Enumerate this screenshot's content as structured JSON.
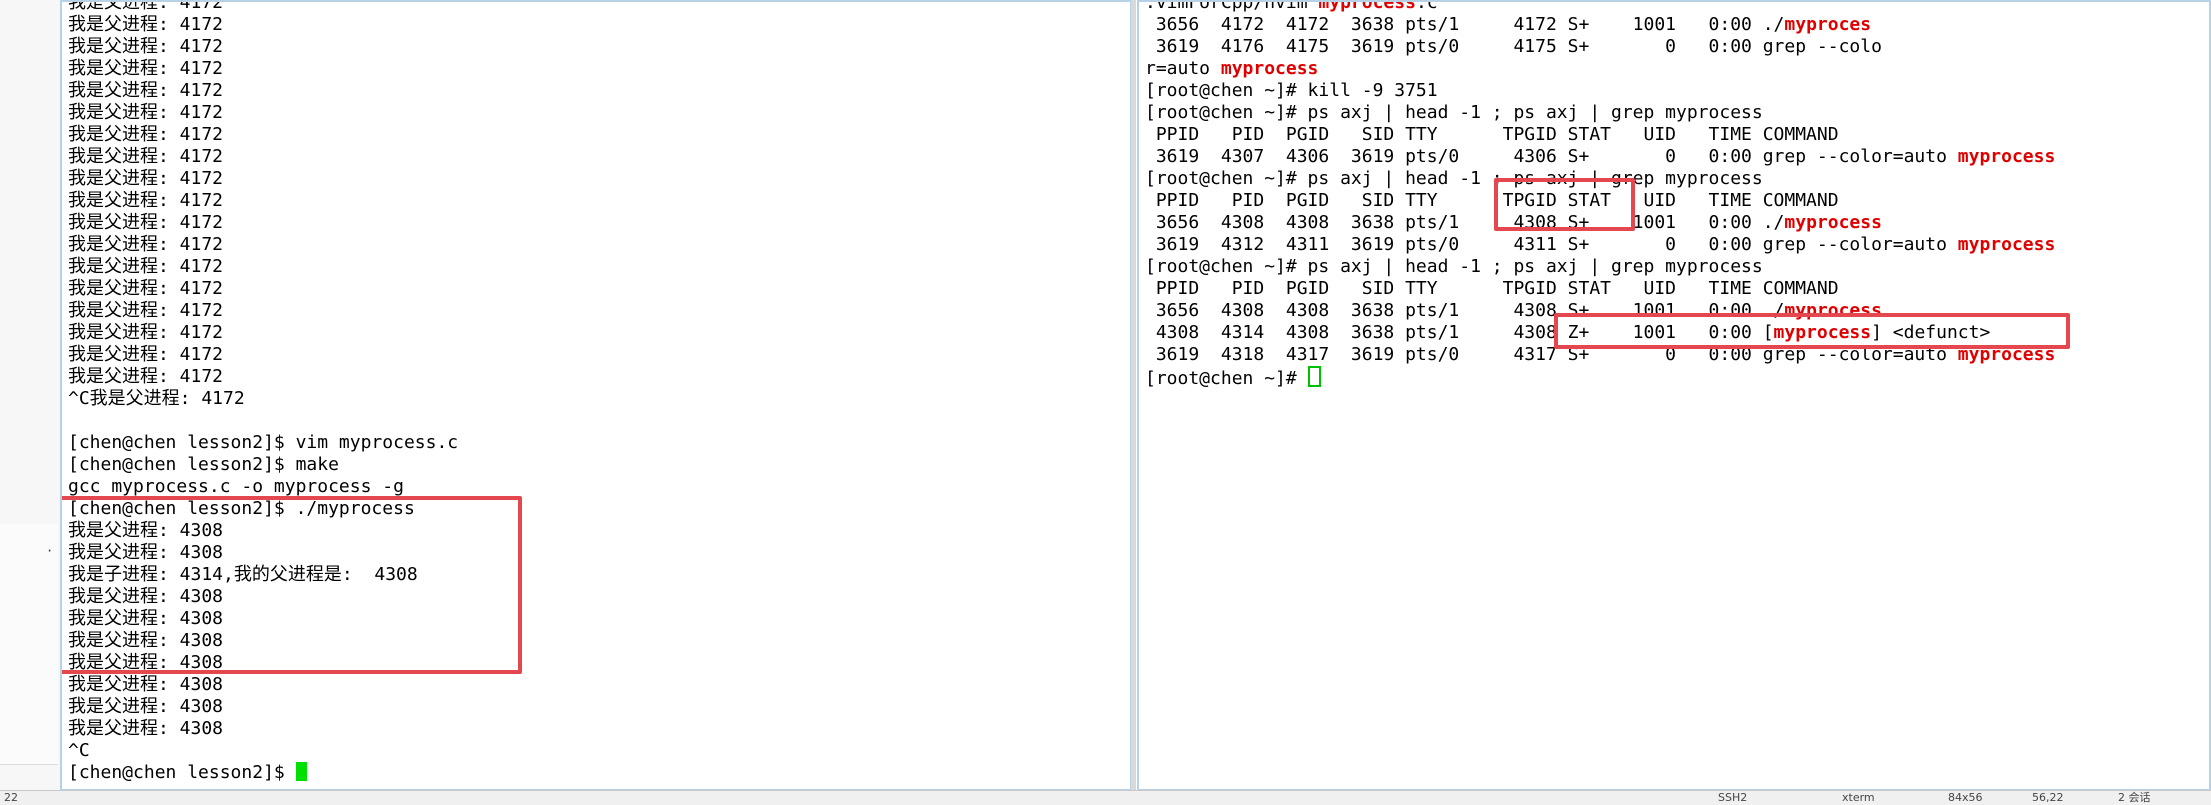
{
  "left_terminal": {
    "lines": [
      "我是父进程: 4172",
      "我是父进程: 4172",
      "我是父进程: 4172",
      "我是父进程: 4172",
      "我是父进程: 4172",
      "我是父进程: 4172",
      "我是父进程: 4172",
      "我是父进程: 4172",
      "我是父进程: 4172",
      "我是父进程: 4172",
      "我是父进程: 4172",
      "我是父进程: 4172",
      "我是父进程: 4172",
      "我是父进程: 4172",
      "我是父进程: 4172",
      "我是父进程: 4172",
      "我是父进程: 4172",
      "我是父进程: 4172",
      "^C我是父进程: 4172",
      "",
      "[chen@chen lesson2]$ vim myprocess.c",
      "[chen@chen lesson2]$ make",
      "gcc myprocess.c -o myprocess -g",
      "[chen@chen lesson2]$ ./myprocess",
      "我是父进程: 4308",
      "我是父进程: 4308",
      "我是子进程: 4314,我的父进程是:  4308",
      "我是父进程: 4308",
      "我是父进程: 4308",
      "我是父进程: 4308",
      "我是父进程: 4308",
      "我是父进程: 4308",
      "我是父进程: 4308",
      "我是父进程: 4308",
      "^C"
    ],
    "prompt": "[chen@chen lesson2]$ "
  },
  "right_terminal": {
    "lines": [
      [
        {
          "t": ".vimForCpp/nvim "
        },
        {
          "t": "myprocess",
          "hl": true
        },
        {
          "t": ".c"
        }
      ],
      [
        {
          "t": " 3656  4172  4172  3638 pts/1     4172 S+    1001   0:00 ./"
        },
        {
          "t": "myproces",
          "hl": true
        }
      ],
      [
        {
          "t": " 3619  4176  4175  3619 pts/0     4175 S+       0   0:00 grep --colo"
        }
      ],
      [
        {
          "t": "r=auto "
        },
        {
          "t": "myprocess",
          "hl": true
        }
      ],
      [
        {
          "t": "[root@chen ~]# kill -9 3751"
        }
      ],
      [
        {
          "t": "[root@chen ~]# ps axj | head -1 ; ps axj | grep myprocess"
        }
      ],
      [
        {
          "t": " PPID   PID  PGID   SID TTY      TPGID STAT   UID   TIME COMMAND"
        }
      ],
      [
        {
          "t": " 3619  4307  4306  3619 pts/0     4306 S+       0   0:00 grep --color=auto "
        },
        {
          "t": "myprocess",
          "hl": true
        }
      ],
      [
        {
          "t": "[root@chen ~]# ps axj | head -1 ; ps axj | grep myprocess"
        }
      ],
      [
        {
          "t": " PPID   PID  PGID   SID TTY      TPGID STAT   UID   TIME COMMAND"
        }
      ],
      [
        {
          "t": " 3656  4308  4308  3638 pts/1     4308 S+    1001   0:00 ./"
        },
        {
          "t": "myprocess",
          "hl": true
        }
      ],
      [
        {
          "t": " 3619  4312  4311  3619 pts/0     4311 S+       0   0:00 grep --color=auto "
        },
        {
          "t": "myprocess",
          "hl": true
        }
      ],
      [
        {
          "t": "[root@chen ~]# ps axj | head -1 ; ps axj | grep myprocess"
        }
      ],
      [
        {
          "t": " PPID   PID  PGID   SID TTY      TPGID STAT   UID   TIME COMMAND"
        }
      ],
      [
        {
          "t": " 3656  4308  4308  3638 pts/1     4308 S+    1001   0:00 ./"
        },
        {
          "t": "myprocess",
          "hl": true
        }
      ],
      [
        {
          "t": " 4308  4314  4308  3638 pts/1     4308 Z+    1001   0:00 ["
        },
        {
          "t": "myprocess",
          "hl": true
        },
        {
          "t": "] <defunct>"
        }
      ],
      [
        {
          "t": " 3619  4318  4317  3619 pts/0     4317 S+       0   0:00 grep --color=auto "
        },
        {
          "t": "myprocess",
          "hl": true
        }
      ]
    ],
    "prompt": "[root@chen ~]# "
  },
  "statusbar": {
    "left": "22",
    "items": [
      "SSH2",
      "xterm",
      "84x56",
      "56,22",
      "2 会话"
    ]
  },
  "colors": {
    "highlight": "#e00000",
    "annotation": "#e5474f",
    "cursor": "#00e000",
    "pane_border": "#b7d2e6"
  }
}
